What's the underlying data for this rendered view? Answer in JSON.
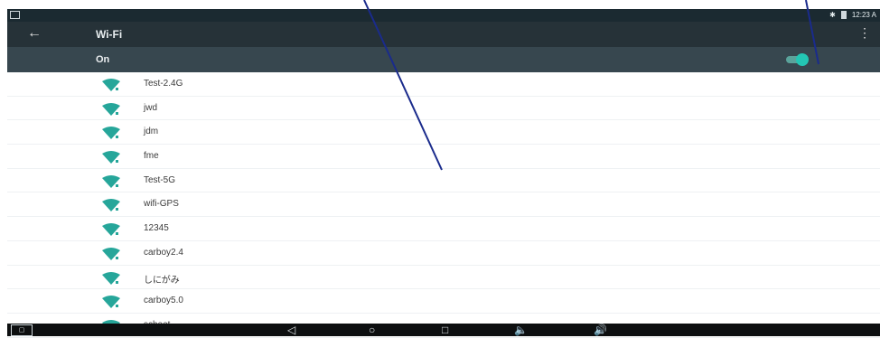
{
  "status_bar": {
    "time": "12:23 A"
  },
  "app_bar": {
    "title": "Wi-Fi",
    "back_icon": "←",
    "menu_icon": "⋮"
  },
  "wifi_toggle": {
    "label": "On",
    "state": "on"
  },
  "networks": [
    {
      "name": "Test-2.4G"
    },
    {
      "name": "jwd"
    },
    {
      "name": "jdm"
    },
    {
      "name": "fme"
    },
    {
      "name": "Test-5G"
    },
    {
      "name": "wifi-GPS"
    },
    {
      "name": "12345"
    },
    {
      "name": "carboy2.4"
    },
    {
      "name": "しにがみ"
    },
    {
      "name": "carboy5.0"
    },
    {
      "name": "scheet"
    }
  ],
  "nav_bar": {
    "back": "◁",
    "home": "○",
    "recents": "□",
    "vol_down": "🔈",
    "vol_up": "🔊"
  },
  "colors": {
    "app_bar": "#263238",
    "on_bar": "#37474f",
    "accent": "#23c6b4",
    "wifi_icon": "#26a69a",
    "annotation_line": "#1a2b8c"
  }
}
